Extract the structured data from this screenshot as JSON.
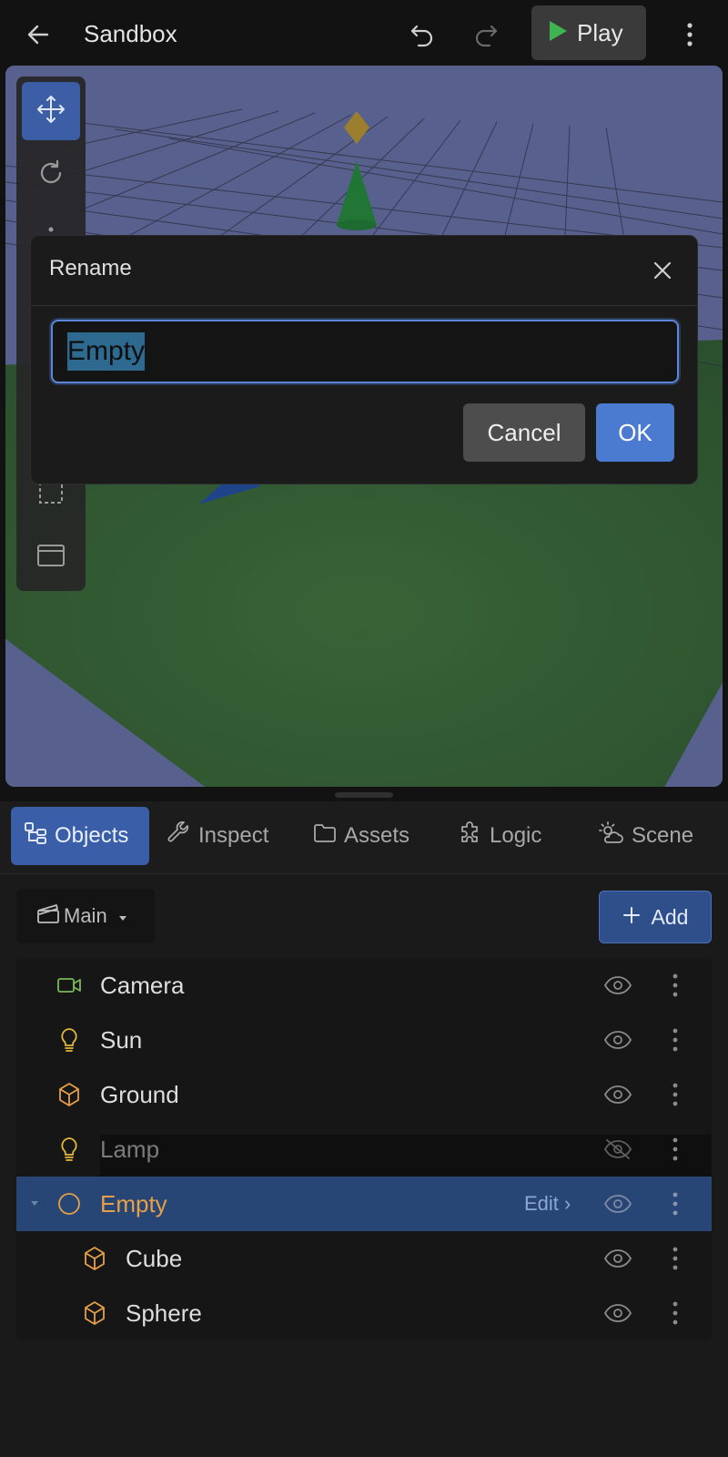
{
  "topbar": {
    "title": "Sandbox",
    "play_label": "Play",
    "icons": [
      "back-arrow-icon",
      "undo-icon",
      "redo-icon",
      "play-icon",
      "more-vertical-icon"
    ]
  },
  "viewport": {
    "tools": [
      "move-icon",
      "rotate-icon",
      "scale-icon",
      "select-box-icon",
      "window-icon"
    ]
  },
  "dialog": {
    "title": "Rename",
    "input_value": "Empty",
    "cancel_label": "Cancel",
    "ok_label": "OK"
  },
  "panel": {
    "tabs": [
      {
        "label": "Objects",
        "icon": "hierarchy-icon",
        "active": true
      },
      {
        "label": "Inspect",
        "icon": "wrench-icon",
        "active": false
      },
      {
        "label": "Assets",
        "icon": "folder-icon",
        "active": false
      },
      {
        "label": "Logic",
        "icon": "puzzle-icon",
        "active": false
      },
      {
        "label": "Scene",
        "icon": "weather-icon",
        "active": false
      }
    ],
    "scene_select": "Main",
    "add_label": "Add",
    "objects": [
      {
        "label": "Camera",
        "icon": "camera-icon",
        "visible": true
      },
      {
        "label": "Sun",
        "icon": "lightbulb-icon",
        "visible": true
      },
      {
        "label": "Ground",
        "icon": "cube-icon",
        "visible": true
      },
      {
        "label": "Lamp",
        "icon": "lightbulb-icon",
        "visible": false
      },
      {
        "label": "Empty",
        "icon": "circle-icon",
        "visible": true,
        "selected": true,
        "edit_label": "Edit ›"
      },
      {
        "label": "Cube",
        "icon": "cube-icon",
        "visible": true,
        "child": true
      },
      {
        "label": "Sphere",
        "icon": "cube-icon",
        "visible": true,
        "child": true
      }
    ]
  },
  "colors": {
    "accent": "#3b5ea7",
    "play_green": "#3fb34f",
    "light_yellow": "#e2b93b",
    "mesh_orange": "#e6a047",
    "camera_green": "#7bb85a"
  }
}
